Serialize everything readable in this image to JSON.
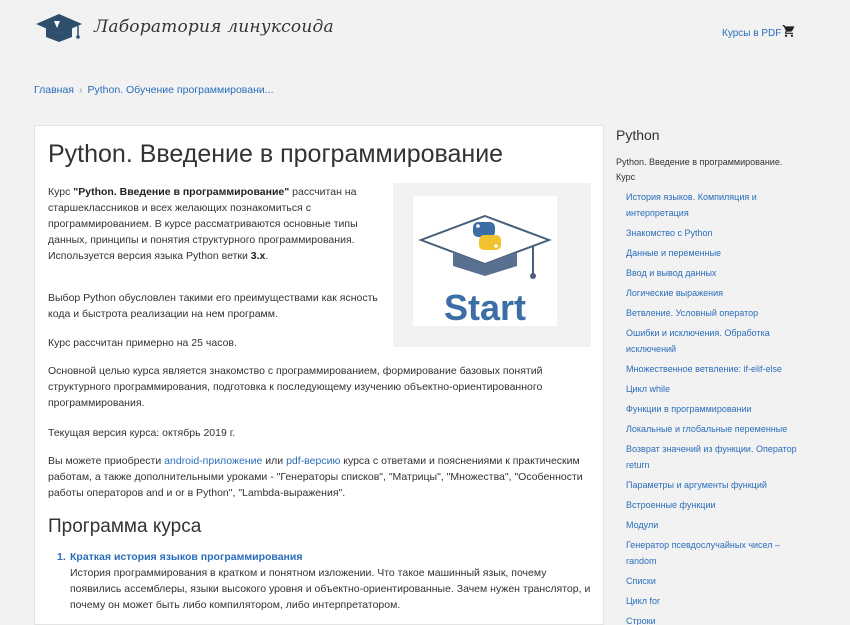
{
  "header": {
    "logo_text": "Лаборатория линуксоида",
    "pdf_link": "Курсы в PDF"
  },
  "breadcrumb": {
    "home": "Главная",
    "current": "Python. Обучение программировани..."
  },
  "main": {
    "title": "Python. Введение в программирование",
    "intro": {
      "prefix": "Курс ",
      "course_name": "\"Python. Введение в программирование\"",
      "text": " рассчитан на старшеклассников и всех желающих познакомиться с программированием. В курсе рассматриваются основные типы данных, принципы и понятия структурного программирования. Используется версия языка Python ветки ",
      "version": "3.x",
      "end": "."
    },
    "p_choice": "Выбор Python обусловлен такими его преимуществами как ясность кода и быстрота реализации на нем программ.",
    "p_hours": "Курс рассчитан примерно на 25 часов.",
    "p_goal": "Основной целью курса является знакомство с программированием, формирование базовых понятий структурного программирования, подготовка к последующему изучению объектно-ориентированного программирования.",
    "p_version": "Текущая версия курса: октябрь 2019 г.",
    "p_buy": {
      "t1": "Вы можете приобрести ",
      "link1": "android-приложение",
      "t2": " или ",
      "link2": "pdf-версию",
      "t3": " курса с ответами и пояснениями к практическим работам, а также дополнительными уроками - \"Генераторы списков\", \"Матрицы\", \"Множества\", \"Особенности работы операторов and и or в Python\", \"Lambda-выражения\"."
    },
    "section_title": "Программа курса",
    "program": [
      {
        "num": "1.",
        "title": "Краткая история языков программирования",
        "desc": "История программирования в кратком и понятном изложении. Что такое машинный язык, почему появились ассемблеры, языки высокого уровня и объектно-ориентированные. Зачем нужен транслятор, и почему он может быть либо компилятором, либо интерпретатором."
      }
    ],
    "image_text": "Start"
  },
  "sidebar": {
    "title": "Python",
    "course": "Python. Введение в программирование. Курс",
    "items": [
      "История языков. Компиляция и интерпретация",
      "Знакомство с Python",
      "Данные и переменные",
      "Ввод и вывод данных",
      "Логические выражения",
      "Ветвление. Условный оператор",
      "Ошибки и исключения. Обработка исключений",
      "Множественное ветвление: if-elif-else",
      "Цикл while",
      "Функции в программировании",
      "Локальные и глобальные переменные",
      "Возврат значений из функции. Оператор return",
      "Параметры и аргументы функций",
      "Встроенные функции",
      "Модули",
      "Генератор псевдослучайных чисел – random",
      "Списки",
      "Цикл for",
      "Строки"
    ]
  },
  "colors": {
    "link": "#2a6ebb",
    "background": "#f2f2f2",
    "python_blue": "#3a6ea5",
    "python_yellow": "#f2c12e"
  }
}
